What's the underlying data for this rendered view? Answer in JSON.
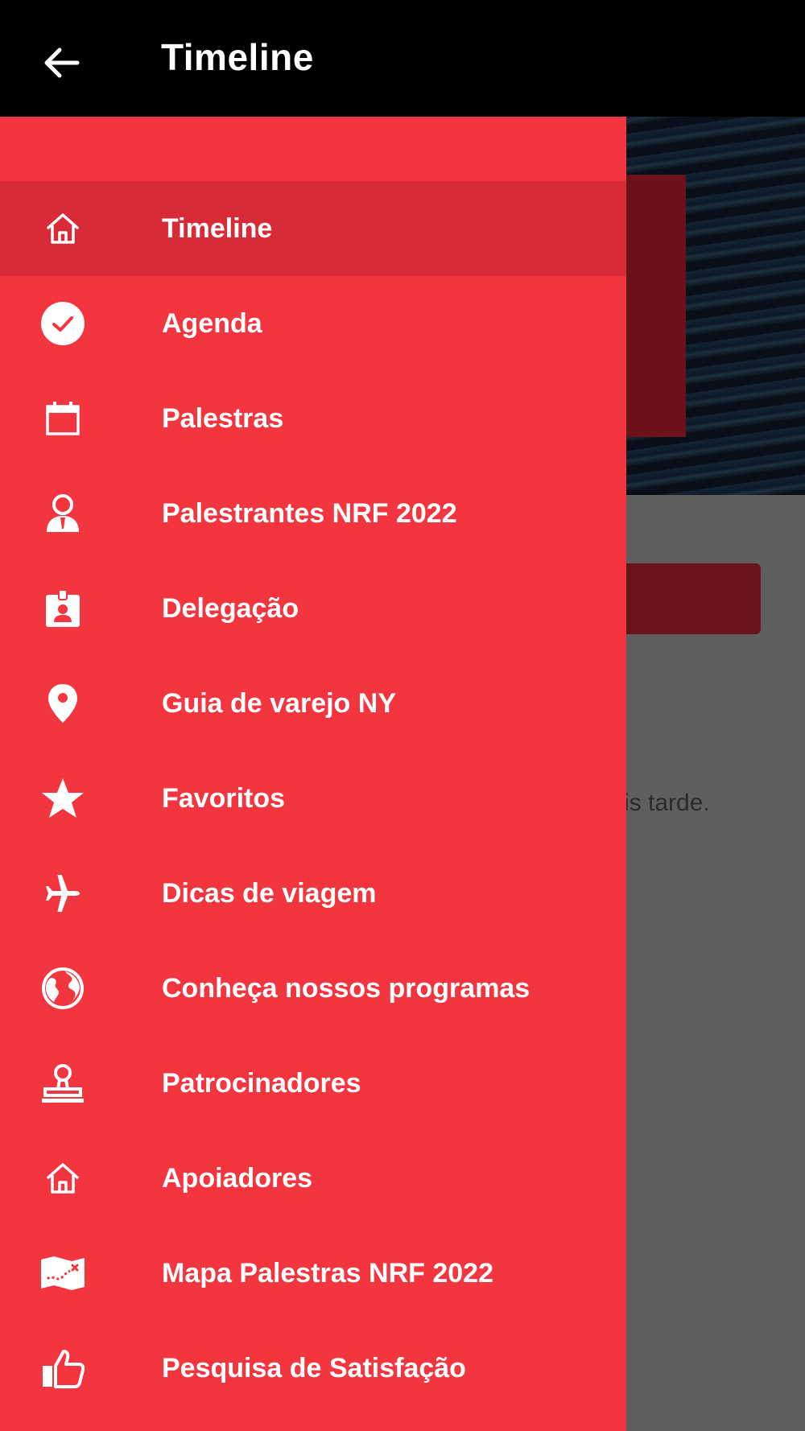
{
  "appbar": {
    "title": "Timeline",
    "back_icon": "arrow-left-icon"
  },
  "background": {
    "partial_text": "is tarde."
  },
  "colors": {
    "appbar": "#000000",
    "drawer": "#f3353f",
    "drawer_active": "#d92b37",
    "text": "#ffffff"
  },
  "menu": {
    "items": [
      {
        "label": "Timeline",
        "icon": "home-icon",
        "active": true
      },
      {
        "label": "Agenda",
        "icon": "check-circle-icon",
        "active": false
      },
      {
        "label": "Palestras",
        "icon": "calendar-icon",
        "active": false
      },
      {
        "label": "Palestrantes NRF 2022",
        "icon": "speaker-person-icon",
        "active": false
      },
      {
        "label": "Delegação",
        "icon": "badge-icon",
        "active": false
      },
      {
        "label": "Guia de varejo NY",
        "icon": "location-pin-icon",
        "active": false
      },
      {
        "label": "Favoritos",
        "icon": "star-icon",
        "active": false
      },
      {
        "label": "Dicas de viagem",
        "icon": "airplane-icon",
        "active": false
      },
      {
        "label": "Conheça nossos programas",
        "icon": "globe-icon",
        "active": false
      },
      {
        "label": "Patrocinadores",
        "icon": "stamp-icon",
        "active": false
      },
      {
        "label": "Apoiadores",
        "icon": "home-icon",
        "active": false
      },
      {
        "label": "Mapa Palestras NRF 2022",
        "icon": "map-icon",
        "active": false
      },
      {
        "label": "Pesquisa de Satisfação",
        "icon": "thumbs-up-icon",
        "active": false
      }
    ]
  }
}
